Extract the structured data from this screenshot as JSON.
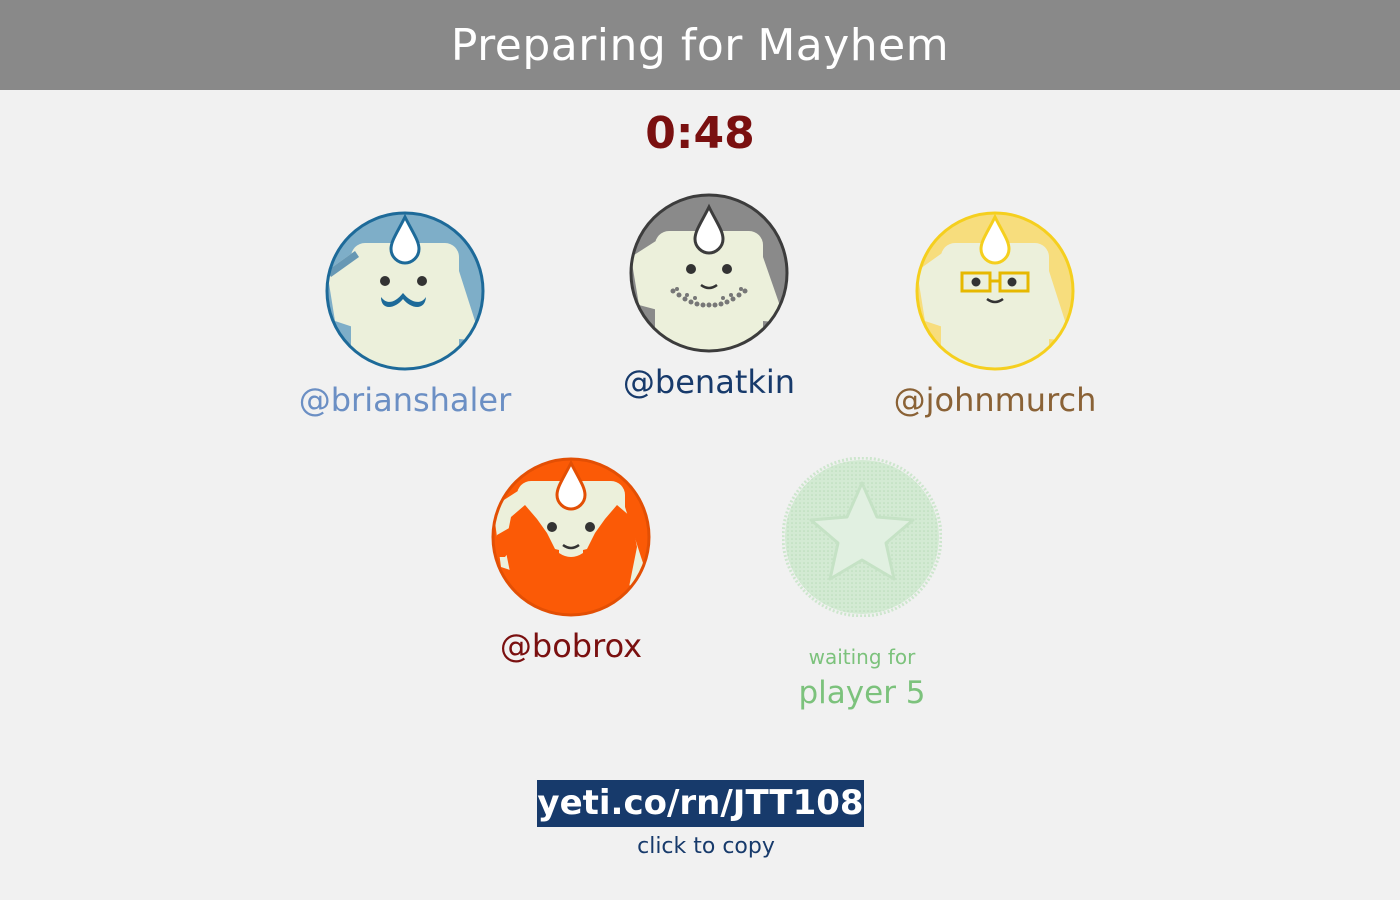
{
  "header": {
    "title": "Preparing for Mayhem"
  },
  "timer": {
    "value": "0:48"
  },
  "players": [
    {
      "handle": "@brianshaler",
      "color": "#6b8fc4",
      "bg": "#7eaec8",
      "ring": "#1d6a99",
      "facial": "mustache"
    },
    {
      "handle": "@benatkin",
      "color": "#173a6b",
      "bg": "#8a8a8a",
      "ring": "#3c3c3c",
      "facial": "stubble"
    },
    {
      "handle": "@johnmurch",
      "color": "#8a6236",
      "bg": "#f7dd7d",
      "ring": "#f5cf1e",
      "facial": "glasses"
    },
    {
      "handle": "@bobrox",
      "color": "#7a1010",
      "bg": "#fb5a06",
      "ring": "#e34f04",
      "facial": "beard"
    }
  ],
  "waiting": {
    "line1": "waiting for",
    "line2": "player 5",
    "color": "#7cc27c",
    "icon": "star-badge-icon"
  },
  "room": {
    "link": "yeti.co/rn/JTT108",
    "hint": "click to copy"
  }
}
